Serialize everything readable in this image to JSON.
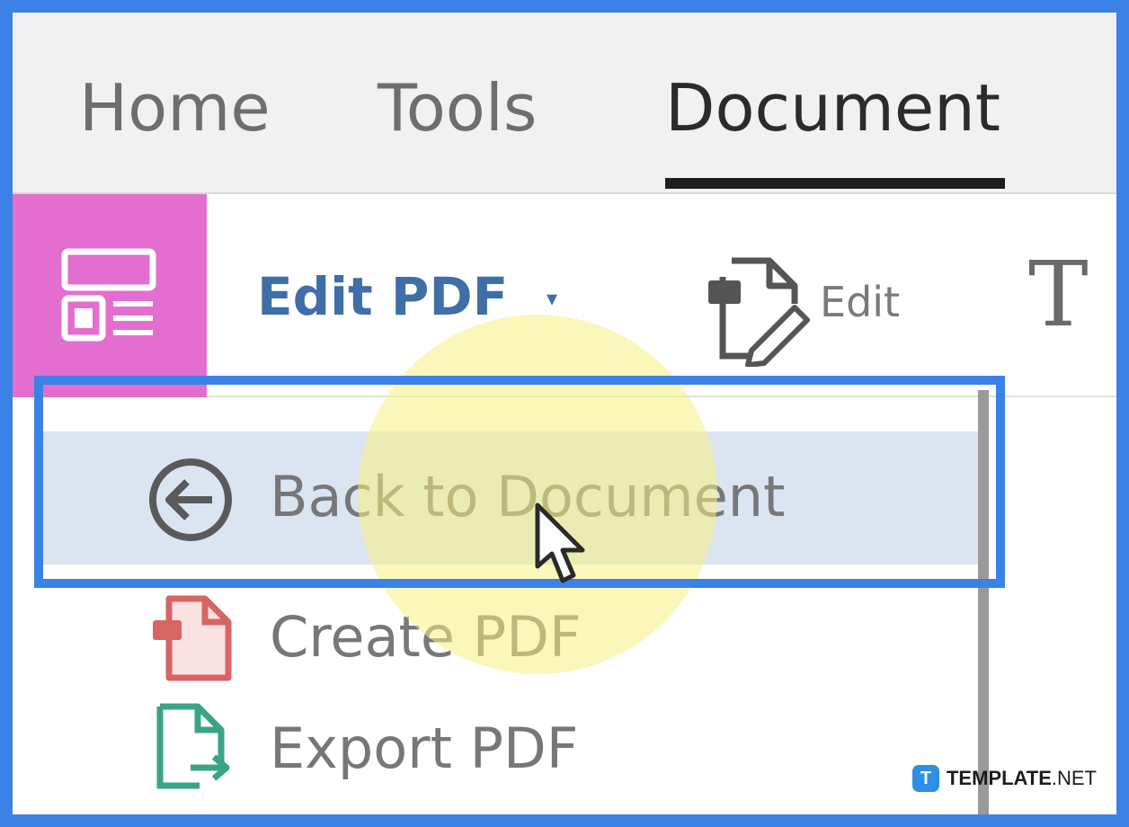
{
  "tabs": {
    "home": "Home",
    "tools": "Tools",
    "document": "Document",
    "active": "Document"
  },
  "toolbar": {
    "edit_pdf_label": "Edit PDF",
    "edit_pdf_caret": "▾",
    "edit_label": "Edit",
    "text_tool_glyph": "T",
    "tile_icon": "layout-icon",
    "edit_icon": "edit-document-icon"
  },
  "menu": {
    "items": [
      {
        "label": "Back to Document",
        "icon": "back-arrow-circle-icon",
        "hovered": true
      },
      {
        "label": "Create PDF",
        "icon": "create-pdf-icon",
        "hovered": false
      },
      {
        "label": "Export PDF",
        "icon": "export-pdf-icon",
        "hovered": false
      }
    ]
  },
  "watermark": {
    "badge": "T",
    "brand": "TEMPLATE",
    "suffix": ".NET"
  },
  "colors": {
    "highlight_border": "#3b82e6",
    "tile_background": "#e46ecf",
    "edit_pdf_text": "#3f6ea8",
    "hover_row": "#dbe5f1",
    "spotlight": "#f8f082"
  }
}
